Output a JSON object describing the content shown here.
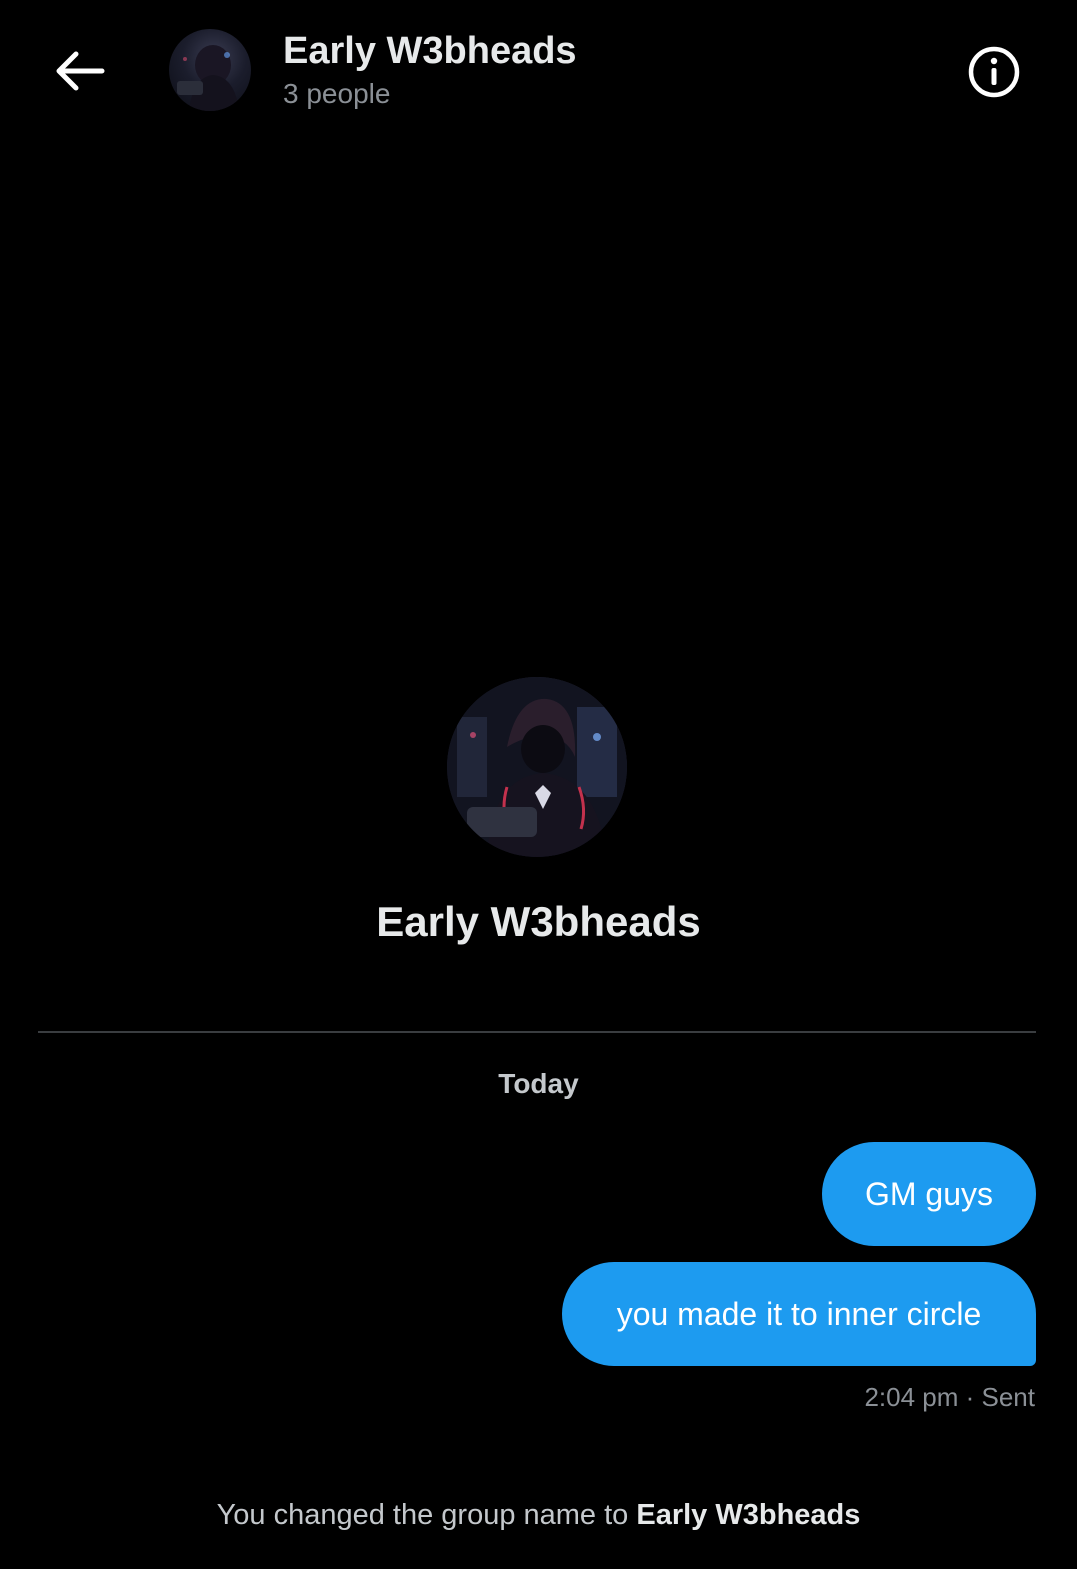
{
  "header": {
    "back_icon": "arrow-left-icon",
    "title": "Early W3bheads",
    "subtitle": "3 people",
    "info_icon": "info-circle-icon"
  },
  "group": {
    "name": "Early W3bheads"
  },
  "timeline": {
    "date_separator": "Today",
    "messages": [
      {
        "text": "GM guys"
      },
      {
        "text": "you made it to inner circle"
      }
    ],
    "status": "2:04 pm · Sent",
    "system_message": {
      "prefix": "You changed the group name to ",
      "name": "Early W3bheads"
    }
  },
  "colors": {
    "background": "#000000",
    "bubble": "#1d9bf0",
    "primary_text": "#e7e9ea",
    "secondary_text": "#8b9096"
  }
}
